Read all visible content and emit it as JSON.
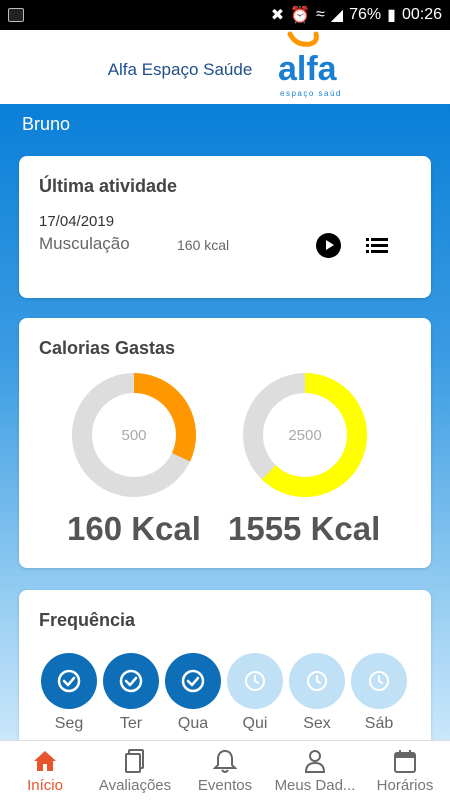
{
  "statusbar": {
    "battery": "76%",
    "time": "00:26"
  },
  "header": {
    "brand": "Alfa Espaço Saúde",
    "logo_word": "alfa",
    "logo_sub": "espaço saúde"
  },
  "user": {
    "name": "Bruno"
  },
  "last_activity": {
    "title": "Última atividade",
    "date": "17/04/2019",
    "activity": "Musculação",
    "kcal": "160 kcal"
  },
  "calories": {
    "title": "Calorias Gastas",
    "gauges": [
      {
        "goal_label": "500",
        "value_label": "160 Kcal",
        "fraction": 0.32,
        "color": "#ff9800"
      },
      {
        "goal_label": "2500",
        "value_label": "1555 Kcal",
        "fraction": 0.622,
        "color": "#ffff00"
      }
    ]
  },
  "frequency": {
    "title": "Frequência",
    "days": [
      {
        "label": "Seg",
        "done": true
      },
      {
        "label": "Ter",
        "done": true
      },
      {
        "label": "Qua",
        "done": true
      },
      {
        "label": "Qui",
        "done": false
      },
      {
        "label": "Sex",
        "done": false
      },
      {
        "label": "Sáb",
        "done": false
      }
    ]
  },
  "nav": {
    "items": [
      {
        "label": "Início",
        "icon": "home-icon"
      },
      {
        "label": "Avaliações",
        "icon": "document-icon"
      },
      {
        "label": "Eventos",
        "icon": "bell-icon"
      },
      {
        "label": "Meus Dad...",
        "icon": "user-icon"
      },
      {
        "label": "Horários",
        "icon": "calendar-icon"
      }
    ]
  },
  "colors": {
    "accent": "#e8542b",
    "primary": "#1a84d2",
    "done": "#0e6fb8",
    "pending": "#bfe0f5"
  }
}
